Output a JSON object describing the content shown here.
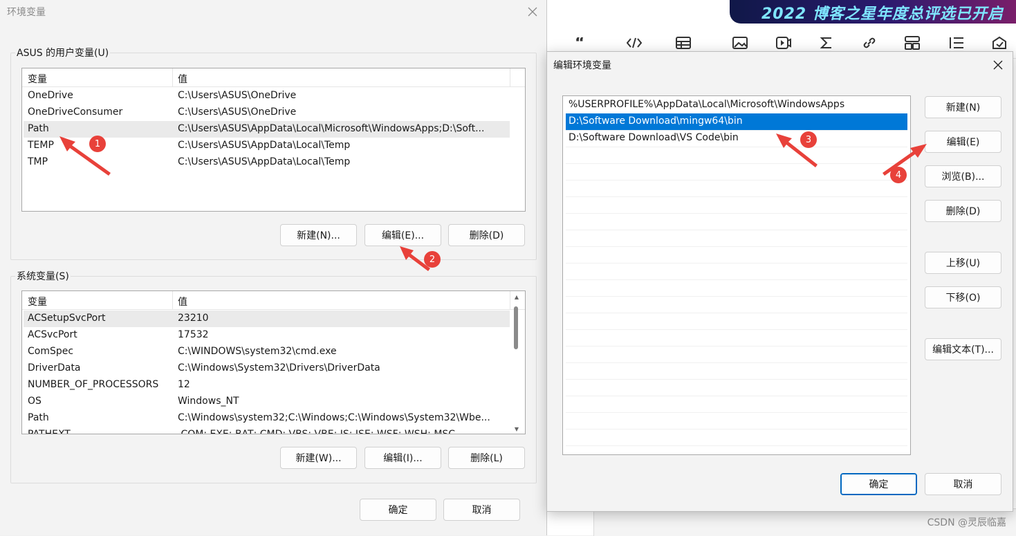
{
  "background": {
    "banner_text": "2022 博客之星年度总评选已开启",
    "watermark": "CSDN @灵辰临嘉",
    "toolbar_icons": [
      "quote-icon",
      "code-icon",
      "table-icon",
      "image-icon",
      "video-icon",
      "sigma-icon",
      "link-icon",
      "layout-icon",
      "list-icon",
      "draft-icon"
    ]
  },
  "env_dialog": {
    "title": "环境变量",
    "user_group": {
      "label": "ASUS 的用户变量(U)",
      "columns": [
        "变量",
        "值"
      ],
      "rows": [
        {
          "name": "OneDrive",
          "value": "C:\\Users\\ASUS\\OneDrive"
        },
        {
          "name": "OneDriveConsumer",
          "value": "C:\\Users\\ASUS\\OneDrive"
        },
        {
          "name": "Path",
          "value": "C:\\Users\\ASUS\\AppData\\Local\\Microsoft\\WindowsApps;D:\\Soft..."
        },
        {
          "name": "TEMP",
          "value": "C:\\Users\\ASUS\\AppData\\Local\\Temp"
        },
        {
          "name": "TMP",
          "value": "C:\\Users\\ASUS\\AppData\\Local\\Temp"
        }
      ],
      "buttons": {
        "new": "新建(N)...",
        "edit": "编辑(E)...",
        "delete": "删除(D)"
      }
    },
    "system_group": {
      "label": "系统变量(S)",
      "columns": [
        "变量",
        "值"
      ],
      "rows": [
        {
          "name": "ACSetupSvcPort",
          "value": "23210"
        },
        {
          "name": "ACSvcPort",
          "value": "17532"
        },
        {
          "name": "ComSpec",
          "value": "C:\\WINDOWS\\system32\\cmd.exe"
        },
        {
          "name": "DriverData",
          "value": "C:\\Windows\\System32\\Drivers\\DriverData"
        },
        {
          "name": "NUMBER_OF_PROCESSORS",
          "value": "12"
        },
        {
          "name": "OS",
          "value": "Windows_NT"
        },
        {
          "name": "Path",
          "value": "C:\\Windows\\system32;C:\\Windows;C:\\Windows\\System32\\Wbe..."
        },
        {
          "name": "PATHEXT",
          "value": ".COM;.EXE;.BAT;.CMD;.VBS;.VBE;.JS;.JSE;.WSF;.WSH;.MSC"
        }
      ],
      "buttons": {
        "new": "新建(W)...",
        "edit": "编辑(I)...",
        "delete": "删除(L)"
      }
    },
    "ok": "确定",
    "cancel": "取消"
  },
  "edit_dialog": {
    "title": "编辑环境变量",
    "entries": [
      "%USERPROFILE%\\AppData\\Local\\Microsoft\\WindowsApps",
      "D:\\Software Download\\mingw64\\bin",
      "D:\\Software Download\\VS Code\\bin"
    ],
    "selected_index": 1,
    "buttons": {
      "new": "新建(N)",
      "edit": "编辑(E)",
      "browse": "浏览(B)...",
      "delete": "删除(D)",
      "move_up": "上移(U)",
      "move_down": "下移(O)",
      "edit_text": "编辑文本(T)..."
    },
    "ok": "确定",
    "cancel": "取消"
  },
  "annotations": [
    "1",
    "2",
    "3",
    "4"
  ],
  "colors": {
    "selection": "#0078d7",
    "annotation": "#e8413a",
    "primary_border": "#0067c0"
  }
}
